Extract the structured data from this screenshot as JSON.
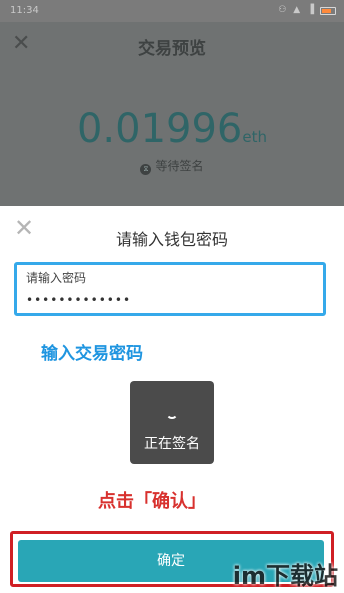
{
  "status_bar": {
    "time": "11:34",
    "icons": "⚇ ▲ ▐"
  },
  "preview": {
    "title": "交易预览",
    "amount": "0.01996",
    "unit": "eth",
    "status": "等待签名",
    "status_icon": "hourglass-icon"
  },
  "sheet": {
    "title": "请输入钱包密码",
    "password_label": "请输入密码",
    "password_value": "•••••••••••••"
  },
  "annotations": {
    "enter_password": "输入交易密码",
    "click_confirm": "点击「确认」"
  },
  "toast": {
    "label": "正在签名"
  },
  "confirm_button": {
    "label": "确定"
  },
  "watermark": "im下载站",
  "colors": {
    "accent_teal": "#29a6b6",
    "highlight_blue": "#35a9ea",
    "highlight_red": "#d01f24",
    "overlay_gray": "#6f7272"
  }
}
